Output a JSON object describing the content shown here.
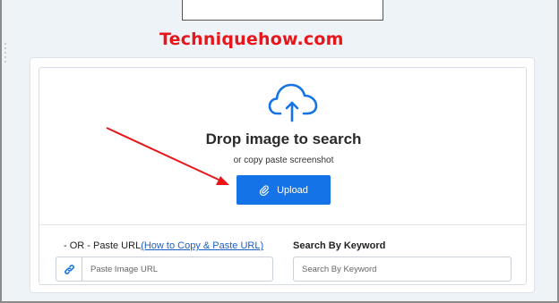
{
  "watermark": "Techniquehow.com",
  "drop_zone": {
    "title": "Drop image to search",
    "subtitle": "or copy paste screenshot",
    "upload_label": "Upload"
  },
  "paste_url": {
    "label_prefix": "- OR - Paste URL",
    "help_link": "(How to Copy & Paste URL)",
    "placeholder": "Paste Image URL"
  },
  "keyword": {
    "label": "Search By Keyword",
    "placeholder": "Search By Keyword"
  },
  "icons": {
    "cloud": "cloud-upload-icon",
    "upload": "paperclip-icon",
    "url": "link-icon"
  },
  "colors": {
    "accent": "#1473e6",
    "watermark": "#e8161b",
    "arrow": "#e8161b"
  }
}
